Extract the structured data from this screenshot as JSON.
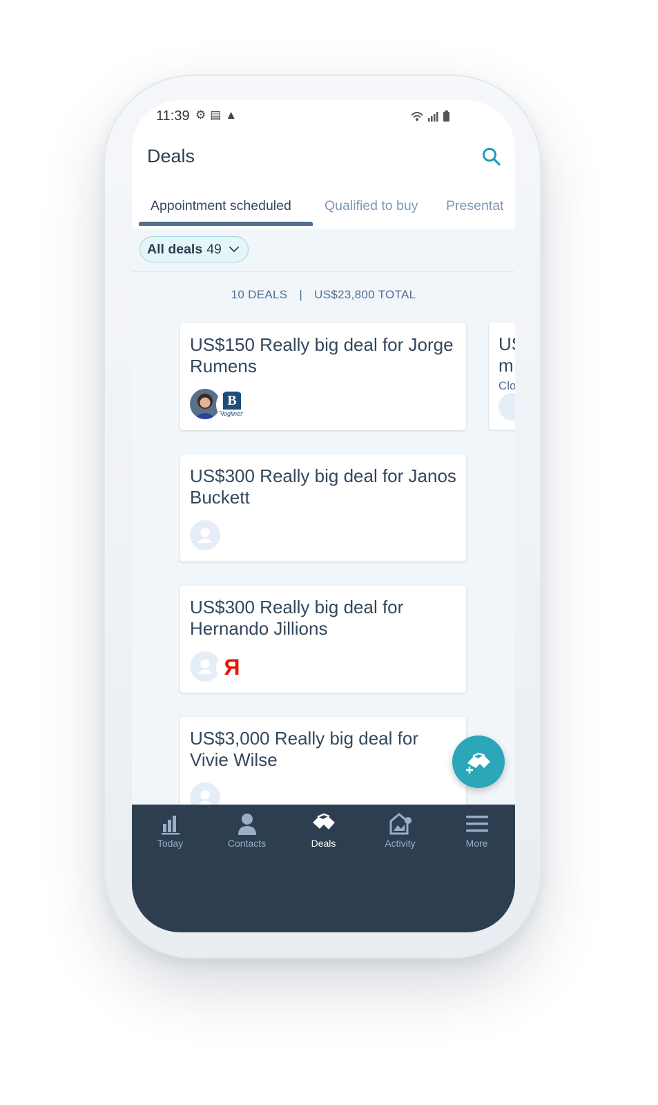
{
  "status_bar": {
    "time": "11:39"
  },
  "header": {
    "title": "Deals"
  },
  "tabs": [
    {
      "label": "Appointment scheduled",
      "active": true
    },
    {
      "label": "Qualified to buy",
      "active": false
    },
    {
      "label": "Presentat",
      "active": false
    }
  ],
  "filter": {
    "label": "All deals",
    "count": "49"
  },
  "summary": {
    "deals": "10 DEALS",
    "separator": "|",
    "total": "US$23,800 TOTAL"
  },
  "deals": [
    {
      "title": "US$150 Really big deal for Jorge Rumens",
      "avatars": [
        "contact-photo",
        "company-logo-bloglines"
      ]
    },
    {
      "title": "US$300 Really big deal for Janos Buckett",
      "avatars": [
        "contact-placeholder"
      ]
    },
    {
      "title": "US$300 Really big deal for Hernando Jillions",
      "avatars": [
        "contact-placeholder",
        "company-logo-yandex"
      ]
    },
    {
      "title": "US$3,000 Really big deal for Vivie Wilse",
      "avatars": [
        "contact-placeholder"
      ]
    }
  ],
  "logos": {
    "bloglines": "Bloglines",
    "bloglines_letter": "B",
    "yandex_letter": "Я"
  },
  "peek_card": {
    "line1": "US",
    "line2": "m",
    "line3": "Clo"
  },
  "bottom_nav": [
    {
      "label": "Today",
      "icon": "bar-chart-icon",
      "active": false
    },
    {
      "label": "Contacts",
      "icon": "person-icon",
      "active": false
    },
    {
      "label": "Deals",
      "icon": "handshake-icon",
      "active": true
    },
    {
      "label": "Activity",
      "icon": "activity-icon",
      "active": false
    },
    {
      "label": "More",
      "icon": "menu-icon",
      "active": false
    }
  ],
  "colors": {
    "accent": "#2aa7b9",
    "nav_background": "#2d3e50",
    "tab_underline": "#516f90",
    "text_primary": "#33475b",
    "text_secondary": "#7c98b6"
  }
}
